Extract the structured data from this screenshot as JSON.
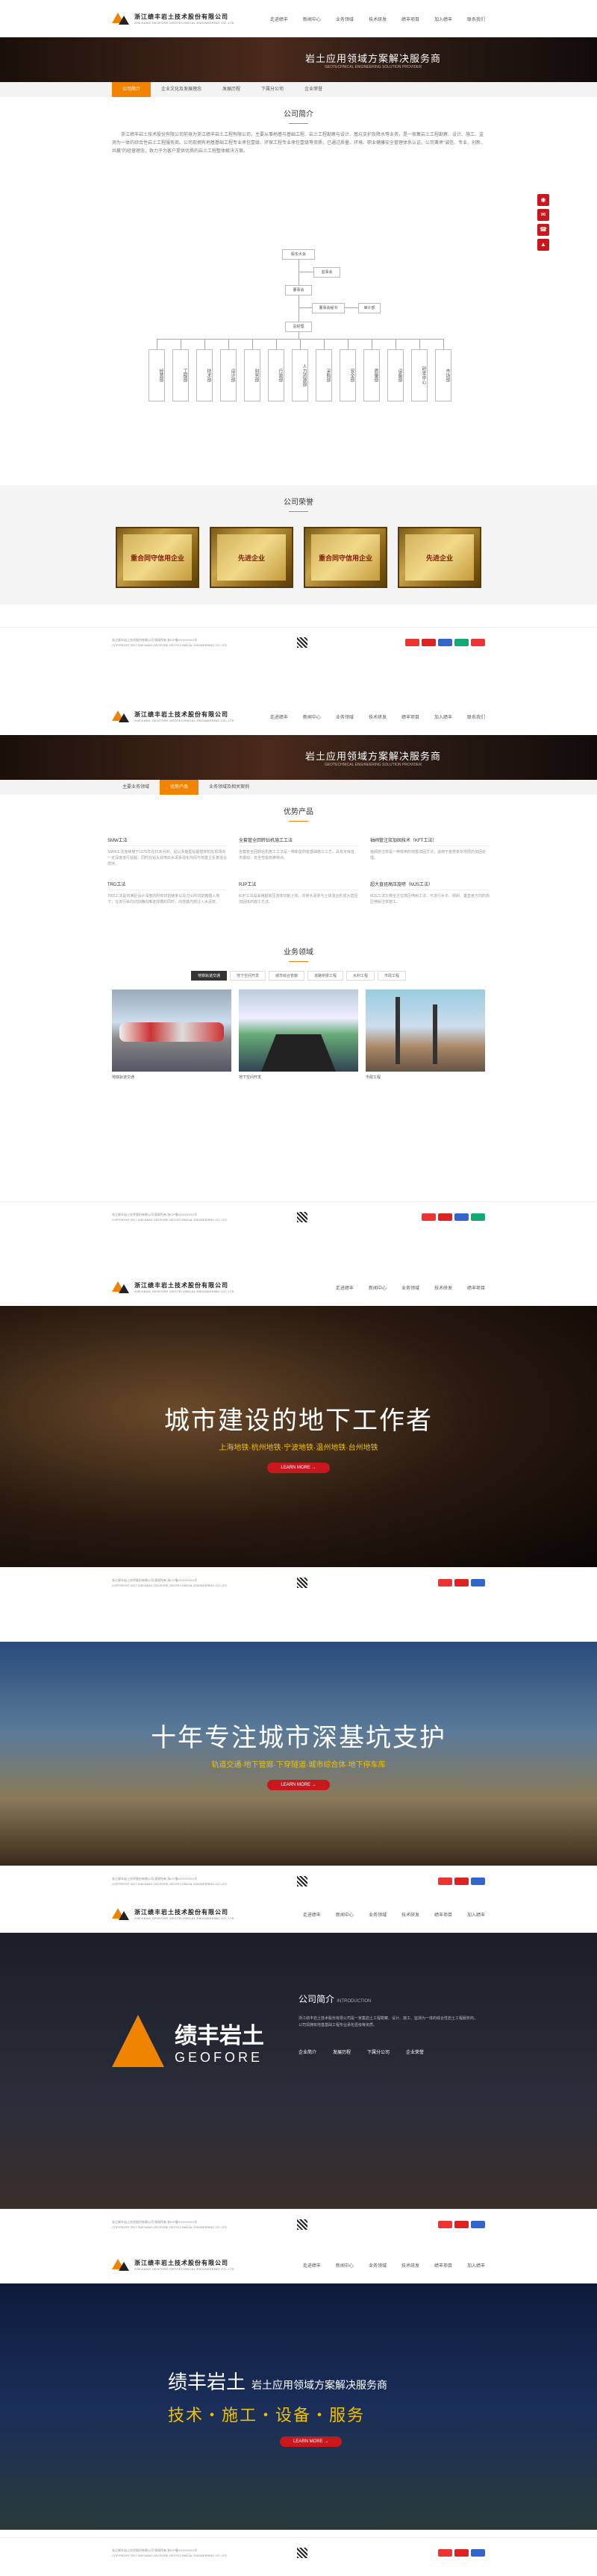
{
  "brand": {
    "name": "浙江绩丰岩土技术股份有限公司",
    "sub": "ZHEJIANG GEOFORE GEOTECHNICAL ENGINEERING CO.,LTD"
  },
  "nav": [
    "走进绩丰",
    "新闻中心",
    "业务领域",
    "技术研发",
    "绩丰项目",
    "加入绩丰",
    "联系我们"
  ],
  "banner": {
    "title": "岩土应用领域方案解决服务商",
    "sub": "GEOTECHNICAL ENGINEERING SOLUTION PROVIDER"
  },
  "page1": {
    "tabs": [
      "公司简介",
      "企业文化及发展理念",
      "发展历程",
      "下属分公司",
      "企业荣誉"
    ],
    "about_title": "公司简介",
    "about_text": "浙江绩丰岩土技术股份有限公司前身为浙江绩丰岩土工程有限公司，主要从事地基与基础工程、岩土工程勘察与设计、基坑支护及降水等业务，是一家集岩土工程勘察、设计、施工、监测为一体的综合性岩土工程服务商。公司现拥有地基基础工程专业承包壹级、环保工程专业承包壹级等资质，已通过质量、环境、职业健康安全管理体系认证。公司秉承“诚信、专业、创新、共赢”的经营理念，致力于为客户提供优质的岩土工程整体解决方案。",
    "org": {
      "top": "股东大会",
      "board": "董事会",
      "supervise": "监事会",
      "gm": "总经理",
      "sec": "董事会秘书",
      "audit": "审计部",
      "vice": "副总经理",
      "depts": [
        "经营部",
        "工程部",
        "技术部",
        "设计部",
        "财务部",
        "行政部",
        "人力资源部",
        "采购部",
        "安全部",
        "质量部",
        "设备部",
        "研发中心",
        "市场部"
      ]
    },
    "honors_title": "公司荣誉",
    "honors": [
      "重合同守信用企业",
      "先进企业",
      "重合同守信用企业",
      "先进企业"
    ]
  },
  "page2": {
    "tabs": [
      "主要业务领域",
      "优势产品",
      "业务领域及相关案例"
    ],
    "products_title": "优势产品",
    "products": [
      {
        "name": "SMW工法",
        "desc": "SMW工法连续墙于1976年在日本问世，是以多轴型钻掘搅拌机在现场向一定深度进行钻掘，同时在钻头处喷出水泥系强化剂而与地基土反复混合搅拌。"
      },
      {
        "name": "全套管全回转钻机施工工法",
        "desc": "全套管全回转钻机施工工法是一种新型的桩基础施工工艺，具有无噪音、无振动、安全性能高等特点。"
      },
      {
        "name": "袖阀管注浆加固技术（KFT工法）",
        "desc": "袖阀管注浆是一种常用的地基加固方法，适用于各类复杂地层的加固处理。"
      },
      {
        "name": "TRD工法",
        "desc": "TRD工法是将满足设计深度的附有切割链条以及刀头的切割箱插入地下，在进行纵向切割横向推进成槽的同时，向地基内部注入水泥浆。"
      },
      {
        "name": "RJP工法",
        "desc": "RJP工法是采用超高压流体切削土体，并使水泥浆与土体混合形成大直径加固体的施工方法。"
      },
      {
        "name": "超大直径高压旋喷（MJS工法）",
        "desc": "MJS工法又称全方位高压喷射工法，可进行水平、倾斜、垂直各方向的高压喷射注浆施工。"
      }
    ],
    "fields_title": "业务领域",
    "field_tabs": [
      "地铁轨道交通",
      "地下空间开发",
      "城市综合管廊",
      "道路桥梁工程",
      "水利工程",
      "市政工程"
    ],
    "fields": [
      {
        "name": "地铁轨道交通"
      },
      {
        "name": "地下空间开发"
      },
      {
        "name": "市政工程"
      }
    ]
  },
  "hero1": {
    "title": "城市建设的地下工作者",
    "sub": "上海地铁·杭州地铁·宁波地铁·温州地铁·台州地铁",
    "btn": "LEARN MORE →"
  },
  "hero2": {
    "title": "十年专注城市深基坑支护",
    "sub": "轨道交通·地下管廊·下穿隧道·城市综合体·地下停车库",
    "btn": "LEARN MORE →"
  },
  "about2": {
    "title": "公司简介",
    "title_en": "INTRODUCTION",
    "text": "浙江绩丰岩土技术股份有限公司是一家集岩土工程勘察、设计、施工、监测为一体的综合性岩土工程服务商，公司现拥有地基基础工程专业承包壹级等资质。",
    "logo_cn": "绩丰岩土",
    "logo_en": "GEOFORE",
    "links": [
      "企业简介",
      "发展历程",
      "下属分公司",
      "企业荣誉"
    ]
  },
  "hero3": {
    "title": "绩丰岩土",
    "title2": "岩土应用领域方案解决服务商",
    "sub": "技术・施工・设备・服务",
    "btn": "LEARN MORE →"
  },
  "footer": {
    "lines": [
      "浙江绩丰岩土技术股份有限公司 版权所有 浙ICP备XXXXXXXX号",
      "COPYRIGHT 2017 ZHEJIANG GEOFORE GEOTECHNICAL ENGINEERING CO.,LTD"
    ]
  },
  "colors": {
    "accent": "#f08300",
    "red": "#c9171e"
  }
}
